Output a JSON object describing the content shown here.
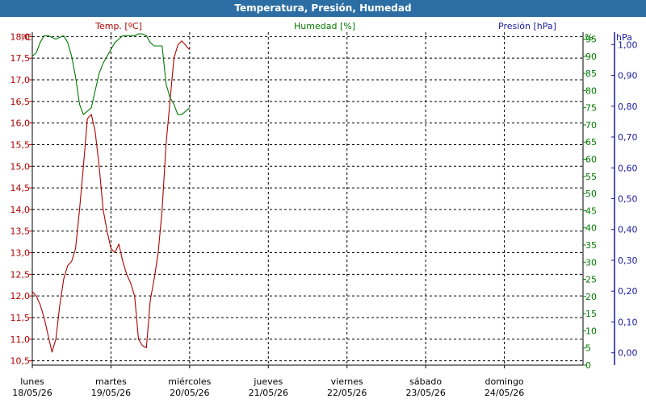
{
  "window": {
    "title": "Temperatura, Presión, Humedad"
  },
  "colors": {
    "temperature": "#b00000",
    "humidity": "#007a00",
    "pressure": "#1a1aa0",
    "grid": "#000000",
    "titlebar": "#2c6ea3"
  },
  "chart_data": {
    "type": "line",
    "grid": true,
    "axes": {
      "temperature": {
        "name": "Temp. [ºC]",
        "unit": "ºC",
        "side": "left",
        "range": [
          10.4,
          18.1
        ],
        "ticks": [
          "10,5",
          "11,0",
          "11,5",
          "12,0",
          "12,5",
          "13,0",
          "13,5",
          "14,0",
          "14,5",
          "15,0",
          "15,5",
          "16,0",
          "16,5",
          "17,0",
          "17,5",
          "18,0"
        ]
      },
      "humidity": {
        "name": "Humedad [%]",
        "unit": "%",
        "side": "right",
        "range": [
          0,
          97
        ],
        "ticks": [
          "0",
          "5",
          "10",
          "15",
          "20",
          "25",
          "30",
          "35",
          "40",
          "45",
          "50",
          "55",
          "60",
          "65",
          "70",
          "75",
          "80",
          "85",
          "90",
          "95"
        ]
      },
      "pressure": {
        "name": "Presión [hPa]",
        "unit": "hPa",
        "side": "right",
        "range": [
          -0.04,
          1.04
        ],
        "ticks": [
          "0,00",
          "0,10",
          "0,20",
          "0,30",
          "0,40",
          "0,50",
          "0,60",
          "0,70",
          "0,80",
          "0,90",
          "1,00"
        ]
      },
      "x": {
        "range": [
          0,
          7
        ],
        "days": [
          {
            "name": "lunes",
            "date": "18/05/26"
          },
          {
            "name": "martes",
            "date": "19/05/26"
          },
          {
            "name": "miércoles",
            "date": "20/05/26"
          },
          {
            "name": "jueves",
            "date": "21/05/26"
          },
          {
            "name": "viernes",
            "date": "22/05/26"
          },
          {
            "name": "sábado",
            "date": "23/05/26"
          },
          {
            "name": "domingo",
            "date": "24/05/26"
          }
        ]
      }
    },
    "series": [
      {
        "name": "Temp. [ºC]",
        "axis": "temperature",
        "color": "#b00000",
        "x": [
          0.0,
          0.05,
          0.1,
          0.15,
          0.2,
          0.25,
          0.3,
          0.35,
          0.4,
          0.45,
          0.5,
          0.55,
          0.6,
          0.65,
          0.7,
          0.75,
          0.8,
          0.85,
          0.9,
          0.95,
          1.0,
          1.05,
          1.1,
          1.15,
          1.2,
          1.25,
          1.3,
          1.35,
          1.4,
          1.45,
          1.5,
          1.55,
          1.6,
          1.65,
          1.7,
          1.75,
          1.8,
          1.85,
          1.9,
          1.95,
          1.97,
          2.0
        ],
        "y": [
          12.1,
          12.0,
          11.8,
          11.5,
          11.1,
          10.7,
          11.0,
          11.8,
          12.4,
          12.7,
          12.8,
          13.1,
          14.0,
          15.0,
          16.1,
          16.2,
          15.8,
          15.0,
          14.0,
          13.5,
          13.1,
          13.0,
          13.2,
          12.8,
          12.5,
          12.3,
          12.0,
          11.0,
          10.85,
          10.8,
          11.9,
          12.4,
          13.0,
          14.0,
          15.5,
          16.5,
          17.5,
          17.8,
          17.9,
          17.8,
          17.75,
          17.7
        ]
      },
      {
        "name": "Humedad [%]",
        "axis": "humidity",
        "color": "#007a00",
        "x": [
          0.0,
          0.05,
          0.1,
          0.15,
          0.2,
          0.25,
          0.3,
          0.35,
          0.4,
          0.45,
          0.5,
          0.55,
          0.6,
          0.65,
          0.7,
          0.75,
          0.8,
          0.85,
          0.9,
          0.95,
          1.0,
          1.05,
          1.1,
          1.15,
          1.2,
          1.25,
          1.3,
          1.35,
          1.4,
          1.45,
          1.5,
          1.55,
          1.6,
          1.65,
          1.7,
          1.75,
          1.8,
          1.85,
          1.9,
          1.95,
          2.0
        ],
        "y": [
          90,
          91,
          94,
          96,
          96,
          95.5,
          95,
          95.5,
          96,
          94,
          90,
          84,
          76,
          73,
          74,
          75,
          80,
          85,
          88,
          90,
          92,
          94,
          95,
          96,
          96,
          96,
          96,
          96.5,
          96.5,
          96,
          94,
          93,
          93,
          93,
          82,
          78,
          76,
          73,
          73,
          74,
          75
        ]
      },
      {
        "name": "Presión [hPa]",
        "axis": "pressure",
        "color": "#1a1aa0",
        "x": [],
        "y": []
      }
    ]
  }
}
